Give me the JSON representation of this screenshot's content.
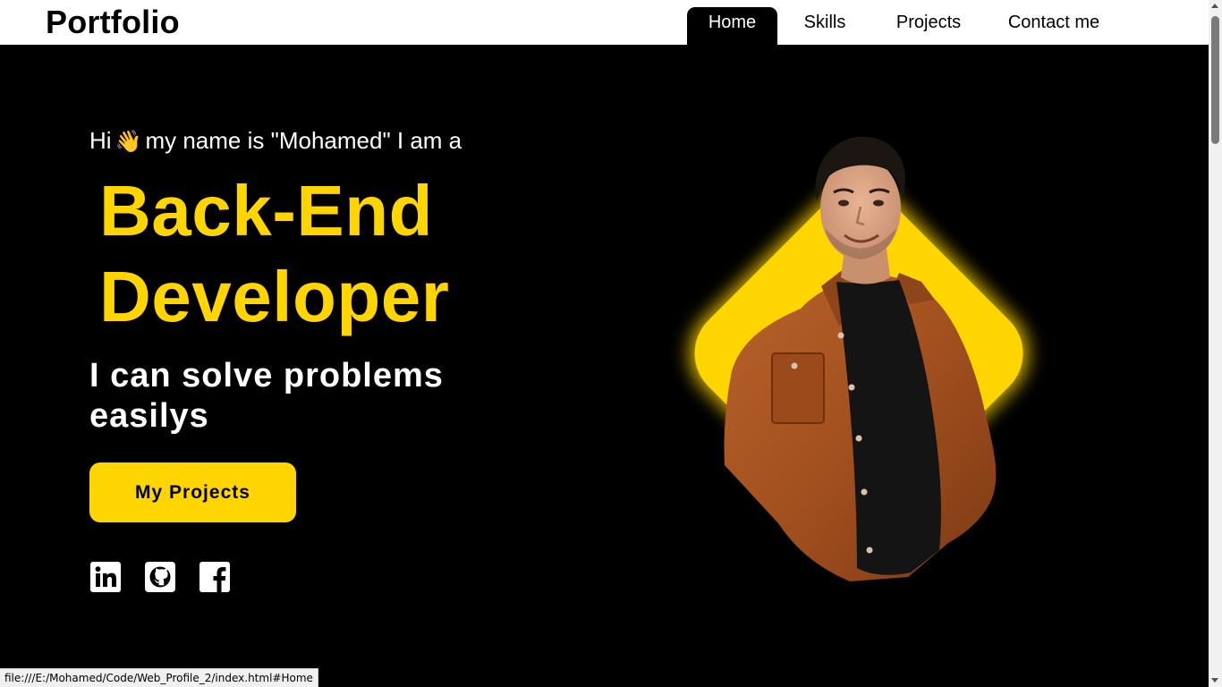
{
  "header": {
    "logo": "Portfolio",
    "nav": [
      {
        "label": "Home",
        "active": true
      },
      {
        "label": "Skills",
        "active": false
      },
      {
        "label": "Projects",
        "active": false
      },
      {
        "label": "Contact me",
        "active": false
      }
    ]
  },
  "hero": {
    "greeting_prefix": "Hi",
    "greeting_emoji": "👋",
    "greeting_suffix": "my name is \"Mohamed\" I am a",
    "role_line1": "Back-End",
    "role_line2": "Developer",
    "tagline": "I can solve problems easilys",
    "cta_label": "My Projects",
    "social_icons": [
      "linkedin-icon",
      "github-icon",
      "facebook-icon"
    ]
  },
  "status_bar": {
    "url": "file:///E:/Mohamed/Code/Web_Profile_2/index.html#Home"
  },
  "colors": {
    "accent": "#ffd500",
    "background": "#000000",
    "header_bg": "#ffffff"
  }
}
